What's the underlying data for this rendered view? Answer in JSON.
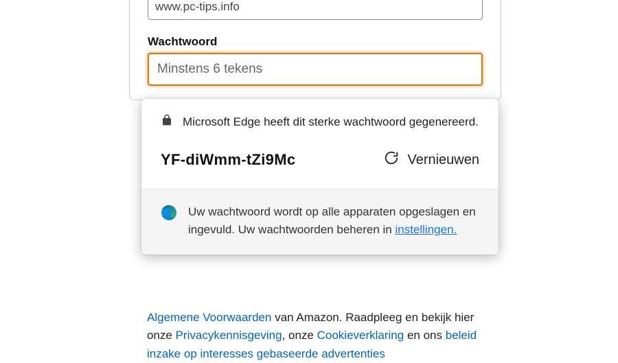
{
  "form": {
    "urlValue": "www.pc-tips.info",
    "passwordLabel": "Wachtwoord",
    "passwordPlaceholder": "Minstens 6 tekens"
  },
  "popup": {
    "headerText": "Microsoft Edge heeft dit sterke wachtwoord gegenereerd.",
    "generatedPassword": "YF-diWmm-tZi9Mc",
    "refreshLabel": "Vernieuwen",
    "syncTextBefore": "Uw wachtwoord wordt op alle apparaten opgeslagen en ingevuld. Uw wachtwoorden beheren in ",
    "settingsLink": "instellingen."
  },
  "legal": {
    "linkTerms": "Algemene Voorwaarden",
    "text1": " van Amazon. Raadpleeg en bekijk hier onze ",
    "linkPrivacy": "Privacykennisgeving",
    "text2": ", onze ",
    "linkCookie": "Cookieverklaring",
    "text3": " en ons ",
    "linkInterest": "beleid inzake op interesses gebaseerde advertenties"
  }
}
